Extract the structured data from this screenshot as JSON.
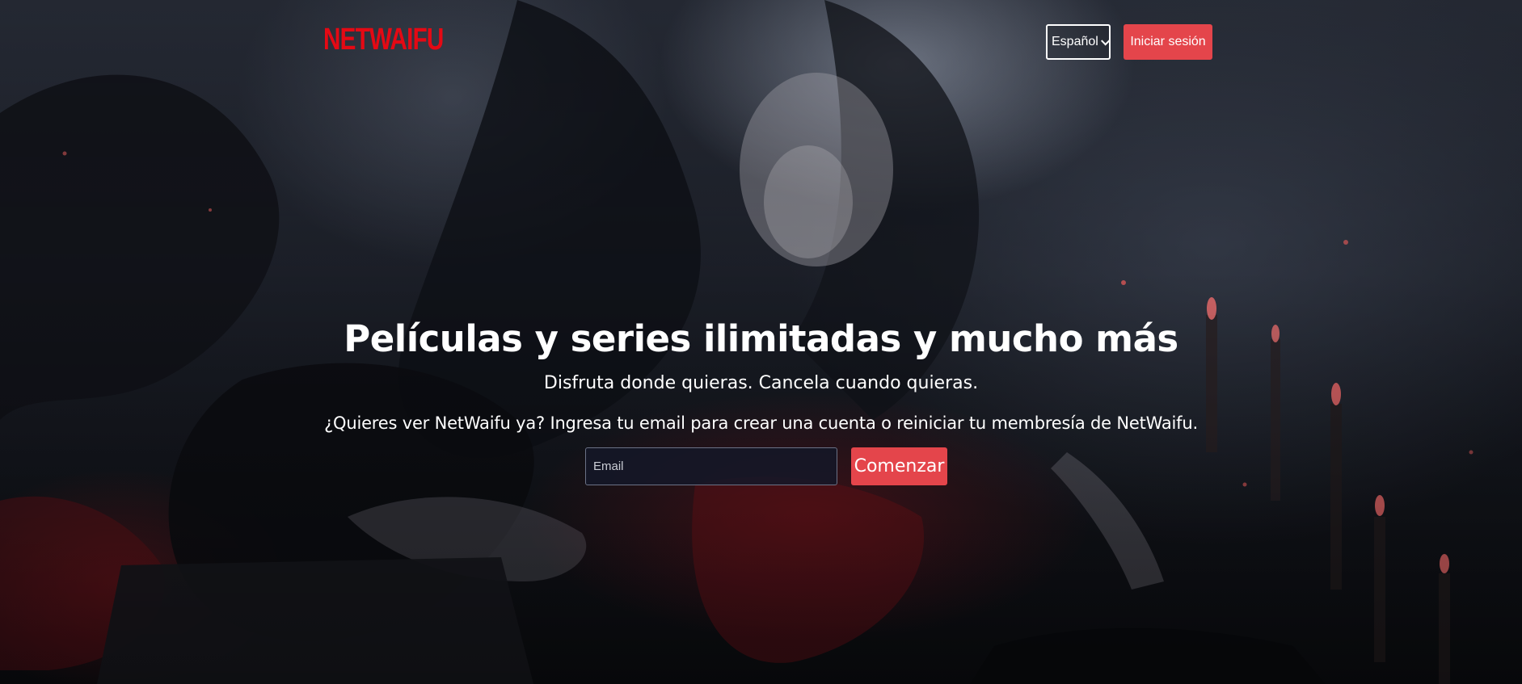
{
  "brand": {
    "logo_text": "NETWAIFU",
    "accent_color": "#e50914",
    "button_color": "#e4454b"
  },
  "header": {
    "language": {
      "selected": "Español",
      "icon": "chevron-down-icon"
    },
    "signin_label": "Iniciar sesión"
  },
  "hero": {
    "title": "Películas y series ilimitadas y mucho más",
    "subtitle": "Disfruta donde quieras. Cancela cuando quieras.",
    "cta_text": "¿Quieres ver NetWaifu ya? Ingresa tu email para crear una cuenta o reiniciar tu membresía de NetWaifu.",
    "email_placeholder": "Email",
    "start_label": "Comenzar"
  }
}
